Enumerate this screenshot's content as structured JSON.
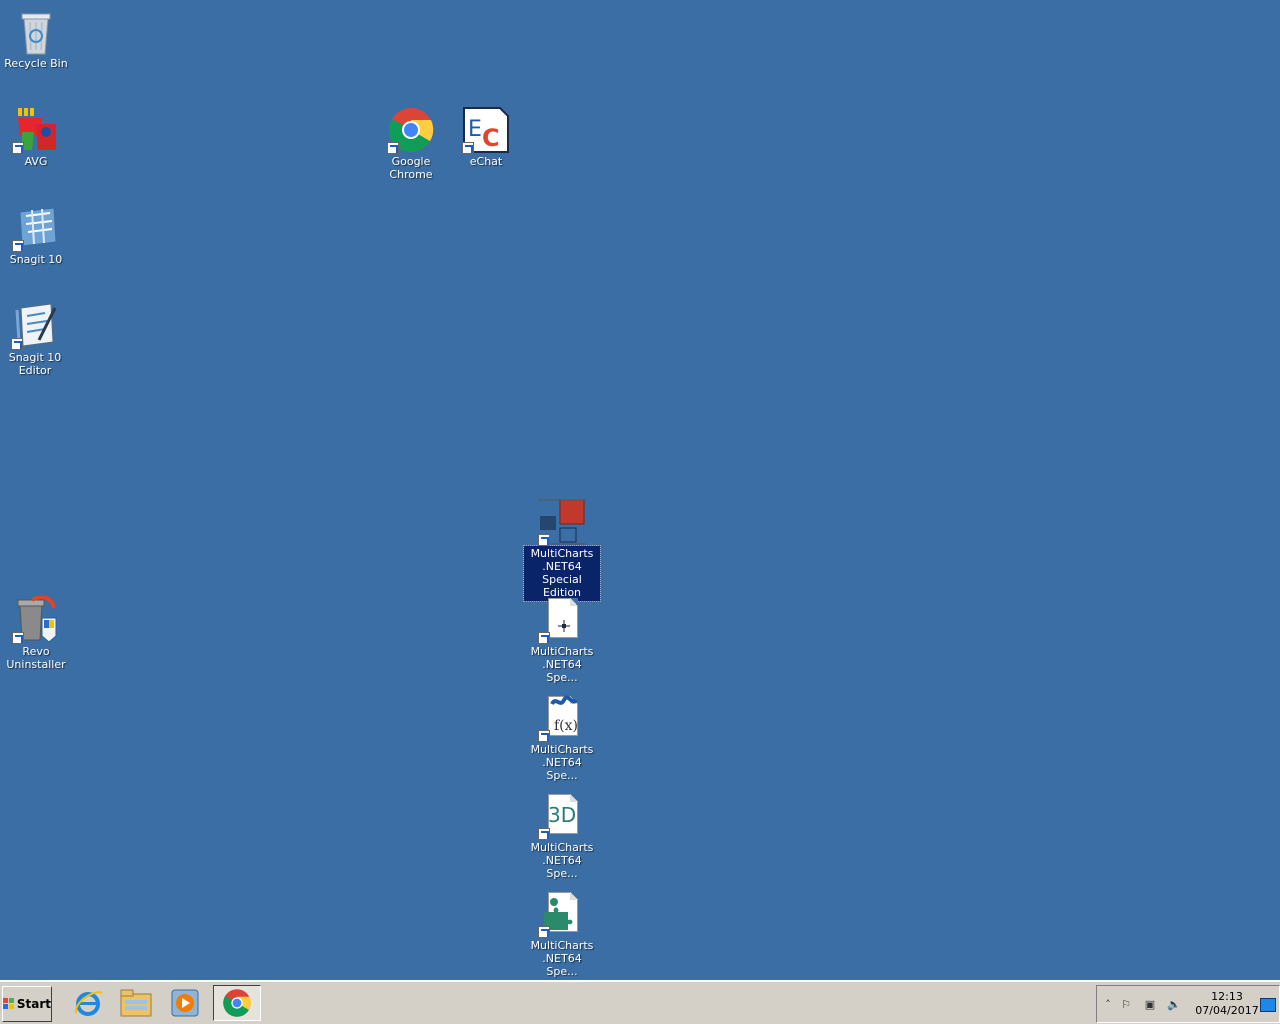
{
  "desktop": {
    "background_color": "#3b6ea5",
    "icons": {
      "recycle_bin": {
        "label": "Recycle Bin",
        "icon": "recycle-bin-icon"
      },
      "avg": {
        "label": "AVG",
        "icon": "avg-icon"
      },
      "snagit": {
        "label": "Snagit 10",
        "icon": "snagit-icon"
      },
      "snagit_editor": {
        "label": "Snagit 10 Editor",
        "icon": "snagit-editor-icon"
      },
      "revo": {
        "label": "Revo Uninstaller",
        "icon": "revo-uninstaller-icon"
      },
      "chrome": {
        "label": "Google Chrome",
        "icon": "chrome-icon"
      },
      "echat": {
        "label": "eChat",
        "icon": "echat-icon",
        "glyph_e": "E",
        "glyph_c": "C"
      },
      "multicharts_main": {
        "label": "MultiCharts .NET64 Special Edition",
        "icon": "multicharts-icon",
        "selected": true
      },
      "multicharts_2": {
        "label": "MultiCharts .NET64 Spe...",
        "icon": "chart-document-icon"
      },
      "multicharts_3": {
        "label": "MultiCharts .NET64 Spe...",
        "icon": "function-editor-icon",
        "glyph": "f(x)"
      },
      "multicharts_4": {
        "label": "MultiCharts .NET64 Spe...",
        "icon": "3d-document-icon",
        "glyph": "3D"
      },
      "multicharts_5": {
        "label": "MultiCharts .NET64 Spe...",
        "icon": "puzzle-document-icon"
      }
    }
  },
  "taskbar": {
    "start_label": "Start",
    "apps": [
      "internet-explorer-icon",
      "windows-explorer-icon",
      "media-player-icon",
      "chrome-icon"
    ],
    "tray": {
      "time": "12:13",
      "date": "07/04/2017"
    }
  }
}
